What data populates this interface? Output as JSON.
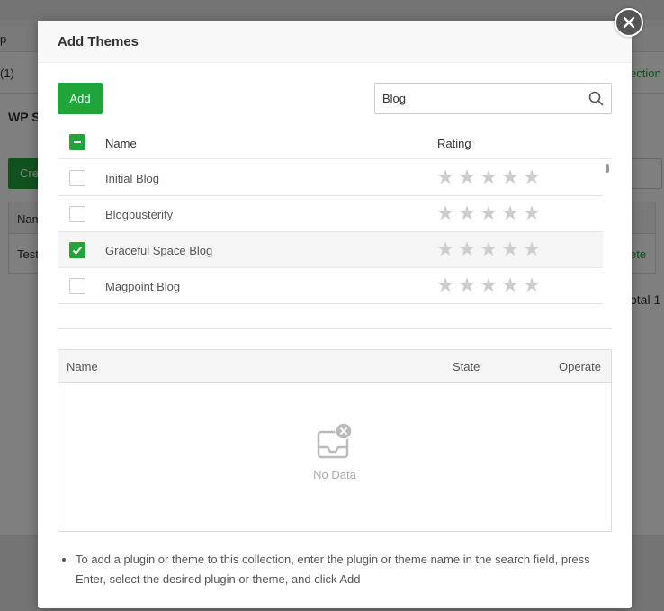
{
  "background": {
    "row1_left": "p",
    "row2_left": "(1)",
    "row2_right": "ection",
    "panel_title": "WP S",
    "create_btn": "Cre",
    "table_header_left": "Nam",
    "table_row_left": "Test",
    "table_row_right": "ete",
    "total": "otal 1"
  },
  "modal": {
    "title": "Add Themes",
    "add_label": "Add",
    "search": {
      "value": "Blog",
      "placeholder": ""
    },
    "columns": {
      "name": "Name",
      "rating": "Rating"
    },
    "themes": [
      {
        "name": "Initial Blog",
        "checked": false,
        "rating": 0
      },
      {
        "name": "Blogbusterify",
        "checked": false,
        "rating": 0
      },
      {
        "name": "Graceful Space Blog",
        "checked": true,
        "rating": 0
      },
      {
        "name": "Magpoint Blog",
        "checked": false,
        "rating": 0
      }
    ],
    "selected_table": {
      "columns": {
        "name": "Name",
        "state": "State",
        "operate": "Operate"
      },
      "empty_text": "No Data"
    },
    "tip": "To add a plugin or theme to this collection, enter the plugin or theme name in the search field, press Enter, select the desired plugin or theme, and click Add"
  },
  "colors": {
    "accent": "#20a53a",
    "star": "#cccccc"
  }
}
